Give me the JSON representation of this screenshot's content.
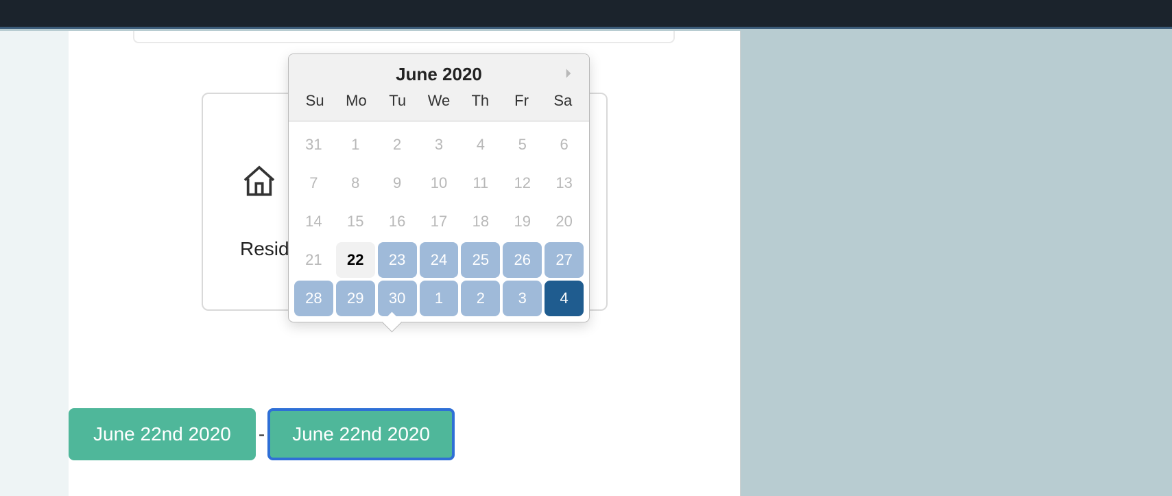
{
  "topbar": {},
  "card": {
    "label": "Resid"
  },
  "date_range": {
    "start_label": "June 22nd 2020",
    "end_label": "June 22nd 2020"
  },
  "calendar": {
    "title": "June 2020",
    "dow": [
      "Su",
      "Mo",
      "Tu",
      "We",
      "Th",
      "Fr",
      "Sa"
    ],
    "cells": [
      {
        "n": "31",
        "state": "disabled"
      },
      {
        "n": "1",
        "state": "disabled"
      },
      {
        "n": "2",
        "state": "disabled"
      },
      {
        "n": "3",
        "state": "disabled"
      },
      {
        "n": "4",
        "state": "disabled"
      },
      {
        "n": "5",
        "state": "disabled"
      },
      {
        "n": "6",
        "state": "disabled"
      },
      {
        "n": "7",
        "state": "disabled"
      },
      {
        "n": "8",
        "state": "disabled"
      },
      {
        "n": "9",
        "state": "disabled"
      },
      {
        "n": "10",
        "state": "disabled"
      },
      {
        "n": "11",
        "state": "disabled"
      },
      {
        "n": "12",
        "state": "disabled"
      },
      {
        "n": "13",
        "state": "disabled"
      },
      {
        "n": "14",
        "state": "disabled"
      },
      {
        "n": "15",
        "state": "disabled"
      },
      {
        "n": "16",
        "state": "disabled"
      },
      {
        "n": "17",
        "state": "disabled"
      },
      {
        "n": "18",
        "state": "disabled"
      },
      {
        "n": "19",
        "state": "disabled"
      },
      {
        "n": "20",
        "state": "disabled"
      },
      {
        "n": "21",
        "state": "disabled"
      },
      {
        "n": "22",
        "state": "today"
      },
      {
        "n": "23",
        "state": "range"
      },
      {
        "n": "24",
        "state": "range"
      },
      {
        "n": "25",
        "state": "range"
      },
      {
        "n": "26",
        "state": "range"
      },
      {
        "n": "27",
        "state": "range"
      },
      {
        "n": "28",
        "state": "range"
      },
      {
        "n": "29",
        "state": "range"
      },
      {
        "n": "30",
        "state": "range"
      },
      {
        "n": "1",
        "state": "range"
      },
      {
        "n": "2",
        "state": "range"
      },
      {
        "n": "3",
        "state": "range"
      },
      {
        "n": "4",
        "state": "selected"
      }
    ]
  }
}
